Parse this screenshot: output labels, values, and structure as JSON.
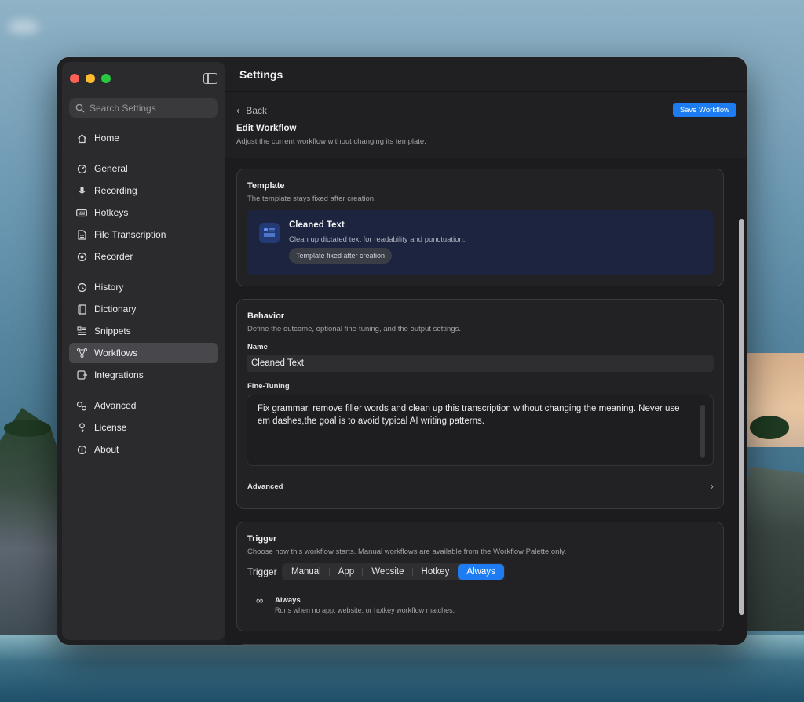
{
  "window": {
    "title": "Settings"
  },
  "sidebar": {
    "search_placeholder": "Search Settings",
    "items": [
      {
        "label": "Home",
        "icon": "house-icon"
      },
      {
        "label": "General",
        "icon": "gauge-icon"
      },
      {
        "label": "Recording",
        "icon": "microphone-icon"
      },
      {
        "label": "Hotkeys",
        "icon": "keyboard-icon"
      },
      {
        "label": "File Transcription",
        "icon": "document-icon"
      },
      {
        "label": "Recorder",
        "icon": "record-icon"
      },
      {
        "label": "History",
        "icon": "clock-icon"
      },
      {
        "label": "Dictionary",
        "icon": "book-icon"
      },
      {
        "label": "Snippets",
        "icon": "text-snippet-icon"
      },
      {
        "label": "Workflows",
        "icon": "workflow-icon"
      },
      {
        "label": "Integrations",
        "icon": "integration-icon"
      },
      {
        "label": "Advanced",
        "icon": "gears-icon"
      },
      {
        "label": "License",
        "icon": "key-icon"
      },
      {
        "label": "About",
        "icon": "info-icon"
      }
    ],
    "active": "Workflows"
  },
  "header": {
    "back_label": "Back",
    "save_label": "Save Workflow",
    "edit_title": "Edit Workflow",
    "edit_subtitle": "Adjust the current workflow without changing its template."
  },
  "template_card": {
    "title": "Template",
    "subtitle": "The template stays fixed after creation.",
    "template_name": "Cleaned Text",
    "template_desc": "Clean up dictated text for readability and punctuation.",
    "badge": "Template fixed after creation"
  },
  "behavior_card": {
    "title": "Behavior",
    "subtitle": "Define the outcome, optional fine-tuning, and the output settings.",
    "name_label": "Name",
    "name_value": "Cleaned Text",
    "finetuning_label": "Fine-Tuning",
    "finetuning_value": "Fix grammar, remove filler words and clean up this transcription without changing the meaning. Never use em dashes,the goal is to avoid typical AI writing patterns.",
    "advanced_label": "Advanced"
  },
  "trigger_card": {
    "title": "Trigger",
    "subtitle": "Choose how this workflow starts. Manual workflows are available from the Workflow Palette only.",
    "trigger_label": "Trigger",
    "options": [
      "Manual",
      "App",
      "Website",
      "Hotkey",
      "Always"
    ],
    "selected": "Always",
    "selected_title": "Always",
    "selected_desc": "Runs when no app, website, or hotkey workflow matches."
  },
  "colors": {
    "accent": "#1d7cf2",
    "sidebar_bg": "#2b2b2d",
    "window_bg": "#1c1c1e",
    "template_box_bg": "#1c2440",
    "traffic_red": "#fe5f57",
    "traffic_yellow": "#febc2e",
    "traffic_green": "#28c840"
  }
}
